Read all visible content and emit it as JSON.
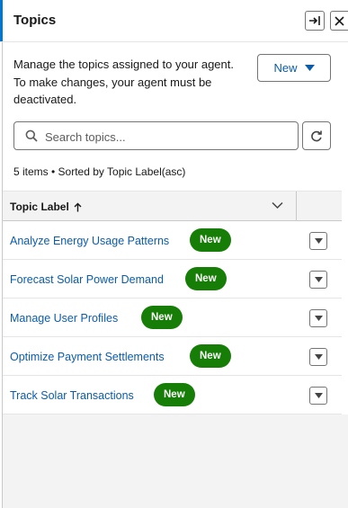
{
  "header": {
    "title": "Topics"
  },
  "description": "Manage the topics assigned to your agent. To make changes, your agent must be deactivated.",
  "new_button": {
    "label": "New"
  },
  "search": {
    "placeholder": "Search topics..."
  },
  "summary": "5 items • Sorted by Topic Label(asc)",
  "table": {
    "column_label": "Topic Label",
    "rows": [
      {
        "label": "Analyze Energy Usage Patterns",
        "badge": "New"
      },
      {
        "label": "Forecast Solar Power Demand",
        "badge": "New"
      },
      {
        "label": "Manage User Profiles",
        "badge": "New"
      },
      {
        "label": "Optimize Payment Settlements",
        "badge": "New"
      },
      {
        "label": "Track Solar Transactions",
        "badge": "New"
      }
    ]
  },
  "colors": {
    "accent": "#0176d3",
    "link": "#0b5cab",
    "badge": "#167e06"
  },
  "icons": [
    "dock-panel-icon",
    "close-icon",
    "chevron-down-icon",
    "search-icon",
    "refresh-icon",
    "sort-arrow-up-icon",
    "row-menu-chevron-icon"
  ]
}
